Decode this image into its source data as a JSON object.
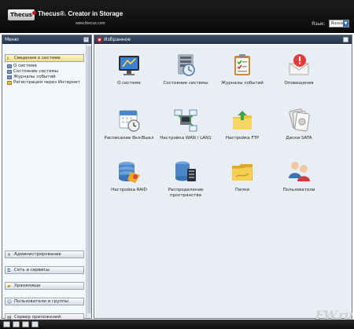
{
  "header": {
    "logo_text": "Thecus",
    "tagline": "Thecus®. Creator in Storage",
    "url": "www.thecus.com",
    "language_label": "Язык:",
    "language_value": "Russia"
  },
  "menu": {
    "title": "Меню",
    "sections": [
      {
        "label": "Сведения о системе",
        "icon": "info-icon",
        "active": true
      },
      {
        "label": "Администрирование",
        "icon": "tools-icon",
        "active": false
      },
      {
        "label": "Сеть и сервисы",
        "icon": "network-icon",
        "active": false
      },
      {
        "label": "Хранилище",
        "icon": "storage-icon",
        "active": false
      },
      {
        "label": "Пользователи и группы",
        "icon": "users-icon",
        "active": false
      },
      {
        "label": "Сервер приложений",
        "icon": "server-icon",
        "active": false
      }
    ],
    "sub_items": [
      {
        "label": "О системе"
      },
      {
        "label": "Состояние системы"
      },
      {
        "label": "Журналы событий"
      },
      {
        "label": "Регистрация через Интернет"
      }
    ]
  },
  "content": {
    "title": "Избранное",
    "tiles": [
      {
        "label": "О системе",
        "icon": "monitor-icon"
      },
      {
        "label": "Состояние системы",
        "icon": "system-status-icon"
      },
      {
        "label": "Журналы событий",
        "icon": "clipboard-icon"
      },
      {
        "label": "Оповещения",
        "icon": "alert-icon"
      },
      {
        "label": "Расписание Вкл/Выкл",
        "icon": "calendar-clock-icon"
      },
      {
        "label": "Настройка WAN / LAN1",
        "icon": "network-config-icon"
      },
      {
        "label": "Настройка FTP",
        "icon": "ftp-folder-icon"
      },
      {
        "label": "Диски SATA",
        "icon": "disks-icon"
      },
      {
        "label": "Настройка RAID",
        "icon": "raid-icon"
      },
      {
        "label": "Распределение пространства",
        "icon": "space-allocation-icon"
      },
      {
        "label": "Папки",
        "icon": "folder-icon"
      },
      {
        "label": "Пользователи",
        "icon": "users-icon"
      }
    ]
  },
  "watermark": "FW.ru"
}
